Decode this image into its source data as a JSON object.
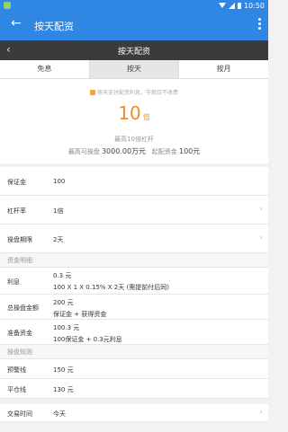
{
  "status_bar": {
    "time": "10:50"
  },
  "app_bar": {
    "back_icon": "arrow-left-icon",
    "title": "按天配资"
  },
  "sub_bar": {
    "back_icon": "chevron-left-icon",
    "title": "按天配资"
  },
  "tabs": [
    {
      "label": "免息"
    },
    {
      "label": "按天"
    },
    {
      "label": "按月"
    }
  ],
  "hero": {
    "notice": "按天支付配资利息，节假日不收费",
    "multiplier": "10",
    "multiplier_unit": "倍",
    "leverage_text": "最高10倍杠杆",
    "max_label": "最高可操盘",
    "max_value": "3000.00万元",
    "min_label": "起配资金",
    "min_value": "100元"
  },
  "form": {
    "margin": {
      "label": "保证金",
      "value": "100"
    },
    "leverage": {
      "label": "杠杆率",
      "value": "1倍"
    },
    "period": {
      "label": "操盘期限",
      "value": "2天"
    },
    "fund_section": "资金明细",
    "interest": {
      "label": "利息",
      "line1": "0.3 元",
      "line2": "100 X 1 X 0.15% X 2天 (需提前付后同)"
    },
    "total": {
      "label": "总操盘金额",
      "line1": "200 元",
      "line2": "保证金 + 获得资金"
    },
    "prepare": {
      "label": "准备资金",
      "line1": "100.3 元",
      "line2": "100保证金 + 0.3元利息"
    },
    "rules_section": "操盘规则",
    "warning": {
      "label": "预警线",
      "value": "150 元"
    },
    "close": {
      "label": "平仓线",
      "value": "130 元"
    },
    "trade_time": {
      "label": "交易时间",
      "value": "今天"
    }
  }
}
